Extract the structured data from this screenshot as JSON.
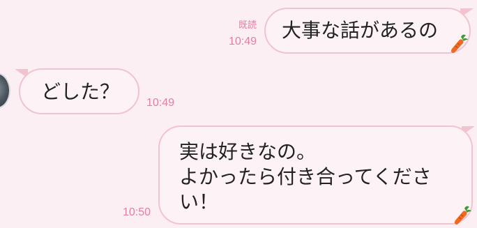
{
  "messages": [
    {
      "direction": "sent",
      "lines": [
        "大事な話があるの"
      ],
      "read_label": "既読",
      "time": "10:49",
      "sticker": "carrot-icon"
    },
    {
      "direction": "received",
      "lines": [
        "どした？"
      ],
      "time": "10:49",
      "avatar": "contact-avatar"
    },
    {
      "direction": "sent",
      "lines": [
        "実は好きなの。",
        "よかったら付き合ってくださ",
        "い！"
      ],
      "time": "10:50",
      "sticker": "carrot-icon"
    }
  ],
  "colors": {
    "background": "#fbeff3",
    "bubble_fill": "#fdf3f6",
    "bubble_border": "#f1c3cf",
    "meta_text": "#e27f9f",
    "message_text": "#222222",
    "carrot_orange": "#f06a22",
    "carrot_leaf": "#3d9b3a"
  }
}
